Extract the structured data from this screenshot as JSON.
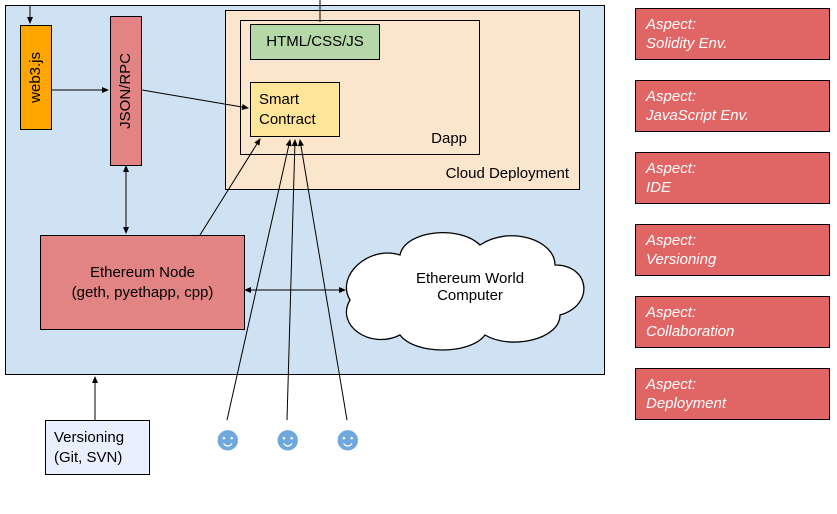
{
  "main": {
    "web3js": "web3.js",
    "jsonrpc": "JSON/RPC",
    "cloud_deploy": "Cloud Deployment",
    "dapp": "Dapp",
    "htmlcssjs": "HTML/CSS/JS",
    "smart_contract": "Smart\nContract",
    "eth_node": "Ethereum Node\n(geth, pyethapp, cpp)",
    "eth_world": "Ethereum World\nComputer",
    "versioning": "Versioning\n(Git, SVN)"
  },
  "aspects": [
    "Aspect:\nSolidity Env.",
    "Aspect:\nJavaScript Env.",
    "Aspect:\nIDE",
    "Aspect:\nVersioning",
    "Aspect:\nCollaboration",
    "Aspect:\nDeployment"
  ]
}
